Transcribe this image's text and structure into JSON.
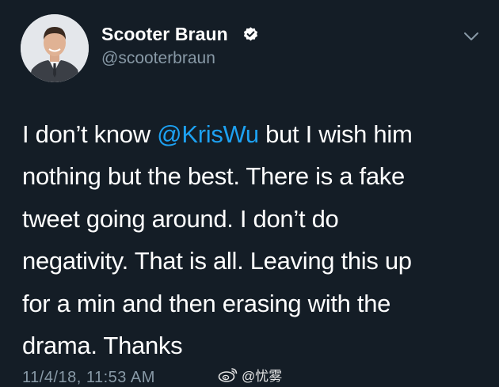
{
  "user": {
    "display_name": "Scooter Braun",
    "handle": "@scooterbraun",
    "verified": true,
    "avatar_icon": "profile-photo"
  },
  "tweet": {
    "lines": [
      {
        "before": "I don’t know ",
        "mention": "@KrisWu",
        "after": " but I wish him"
      },
      {
        "text": "nothing but the best. There is a fake"
      },
      {
        "text": "tweet going around. I don’t do"
      },
      {
        "text": "negativity. That is all. Leaving this up"
      },
      {
        "text": "for a min and then erasing with the"
      },
      {
        "text": "drama. Thanks"
      }
    ],
    "timestamp": "11/4/18, 11:53 AM"
  },
  "watermark": {
    "text": "@忧雾",
    "icon": "weibo-icon"
  },
  "colors": {
    "background": "#141d26",
    "mention": "#1da1f2",
    "secondary_text": "#8899a6",
    "verified_badge": "#ffffff"
  }
}
